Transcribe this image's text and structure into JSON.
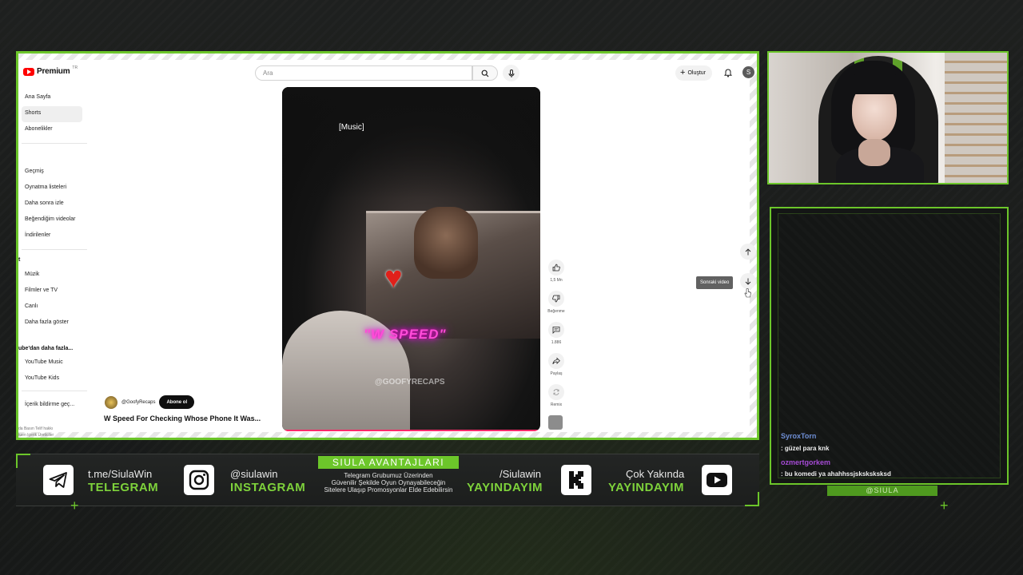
{
  "youtube": {
    "logo_text": "Premium",
    "logo_region": "TR",
    "search_placeholder": "Ara",
    "create_label": "Oluştur",
    "avatar_letter": "S",
    "sidebar": {
      "items": [
        {
          "label": "Ana Sayfa"
        },
        {
          "label": "Shorts"
        },
        {
          "label": "Abonelikler"
        },
        {
          "label": "Geçmiş"
        },
        {
          "label": "Oynatma listeleri"
        },
        {
          "label": "Daha sonra izle"
        },
        {
          "label": "Beğendiğim videolar"
        },
        {
          "label": "İndirilenler"
        },
        {
          "label": "Müzik"
        },
        {
          "label": "Filmler ve TV"
        },
        {
          "label": "Canlı"
        },
        {
          "label": "Daha fazla göster"
        },
        {
          "label": "YouTube Music"
        },
        {
          "label": "YouTube Kids"
        },
        {
          "label": "İçerik bildirme geç..."
        }
      ],
      "section_you_fragment": "t",
      "section_more": "ube'dan daha fazla...",
      "footer_line1": "da   Basın   Telif hakkı",
      "footer_line2": "tuen  Içerik Üreticiler"
    },
    "short": {
      "caption": "[Music]",
      "overlay_text": "\"W SPEED\"",
      "watermark": "@GOOFYRECAPS",
      "channel_name": "@GoofyRecaps",
      "subscribe_label": "Abone ol",
      "title": "W Speed For Checking Whose Phone It Was..."
    },
    "actions": {
      "like_count": "1,5 Mn",
      "dislike_label": "Beğenme",
      "comment_count": "1.886",
      "share_label": "Paylaş",
      "remix_label": "Remix"
    },
    "tooltip": "Sonraki video"
  },
  "chat": {
    "messages": [
      {
        "user": "SyroxTorn",
        "text": ": güzel para knk",
        "color": "#6f8fd6"
      },
      {
        "user": "ozmertgorkem",
        "text": ": bu komedi ya ahahhssjsksksksksd",
        "color": "#a64bd6"
      }
    ],
    "handle": "@SIULA"
  },
  "bottom_bar": {
    "telegram": {
      "top": "t.me/SiulaWin",
      "bottom": "TELEGRAM"
    },
    "instagram": {
      "top": "@siulawin",
      "bottom": "INSTAGRAM"
    },
    "promo": {
      "title": "SIULA AVANTAJLARI",
      "line1": "Telegram Grubumuz Üzerinden",
      "line2": "Güvenilir Şekilde Oyun Oynayabileceğin",
      "line3": "Sitelere Ulaşıp Promosyonlar Elde Edebilirsin"
    },
    "kick": {
      "top": "/Siulawin",
      "bottom": "YAYINDAYIM"
    },
    "youtube": {
      "top": "Çok Yakında",
      "bottom": "YAYINDAYIM"
    }
  },
  "colors": {
    "accent": "#6cc62a",
    "accent_text": "#7ed23b",
    "background": "#1b1d1c"
  }
}
